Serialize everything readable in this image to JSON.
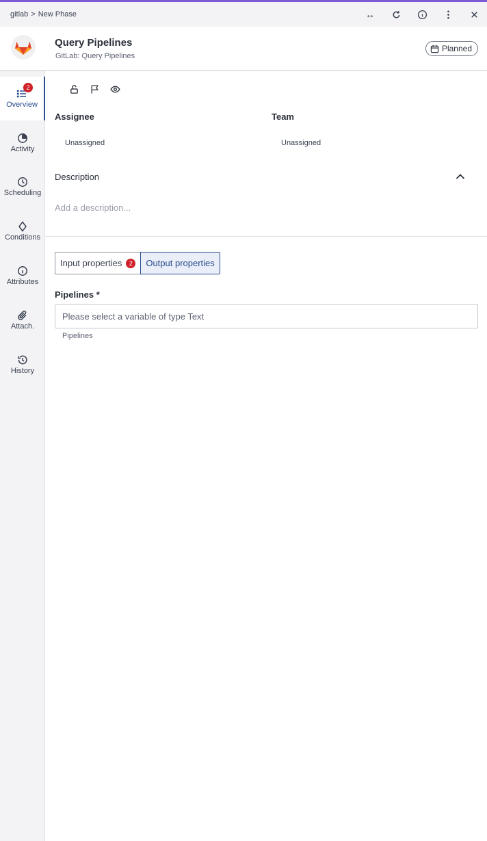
{
  "breadcrumb": {
    "root": "gitlab",
    "separator": ">",
    "current": "New Phase"
  },
  "top_actions": [
    {
      "name": "expand-icon",
      "glyph": "↔"
    },
    {
      "name": "refresh-icon"
    },
    {
      "name": "info-icon"
    },
    {
      "name": "more-vertical-icon"
    },
    {
      "name": "close-icon"
    }
  ],
  "header": {
    "title": "Query Pipelines",
    "subtitle": "GitLab: Query Pipelines",
    "status": "Planned",
    "logo_colors": [
      "#e24329",
      "#fc6d26",
      "#fca326"
    ]
  },
  "sidebar": {
    "items": [
      {
        "id": "overview",
        "label": "Overview",
        "icon": "list-icon",
        "badge": "2",
        "active": true
      },
      {
        "id": "activity",
        "label": "Activity",
        "icon": "pie-icon"
      },
      {
        "id": "scheduling",
        "label": "Scheduling",
        "icon": "clock-icon"
      },
      {
        "id": "conditions",
        "label": "Conditions",
        "icon": "diamond-icon"
      },
      {
        "id": "attributes",
        "label": "Attributes",
        "icon": "info-icon"
      },
      {
        "id": "attach",
        "label": "Attach.",
        "icon": "paperclip-icon"
      },
      {
        "id": "history",
        "label": "History",
        "icon": "history-icon"
      }
    ]
  },
  "toolbar": {
    "icons": [
      "lock-open-icon",
      "flag-icon",
      "eye-icon"
    ]
  },
  "assignee": {
    "label": "Assignee",
    "value": "Unassigned"
  },
  "team": {
    "label": "Team",
    "value": "Unassigned"
  },
  "description": {
    "label": "Description",
    "placeholder": "Add a description..."
  },
  "tabs": {
    "input": {
      "label": "Input properties",
      "badge": "2"
    },
    "output": {
      "label": "Output properties",
      "active": true
    }
  },
  "pipelines": {
    "label": "Pipelines *",
    "placeholder": "Please select a variable of type Text",
    "value": "",
    "help": "Pipelines"
  },
  "colors": {
    "accent": "#2a4b8d",
    "badge": "#d0212a",
    "top_line": "#7e5bd6"
  }
}
